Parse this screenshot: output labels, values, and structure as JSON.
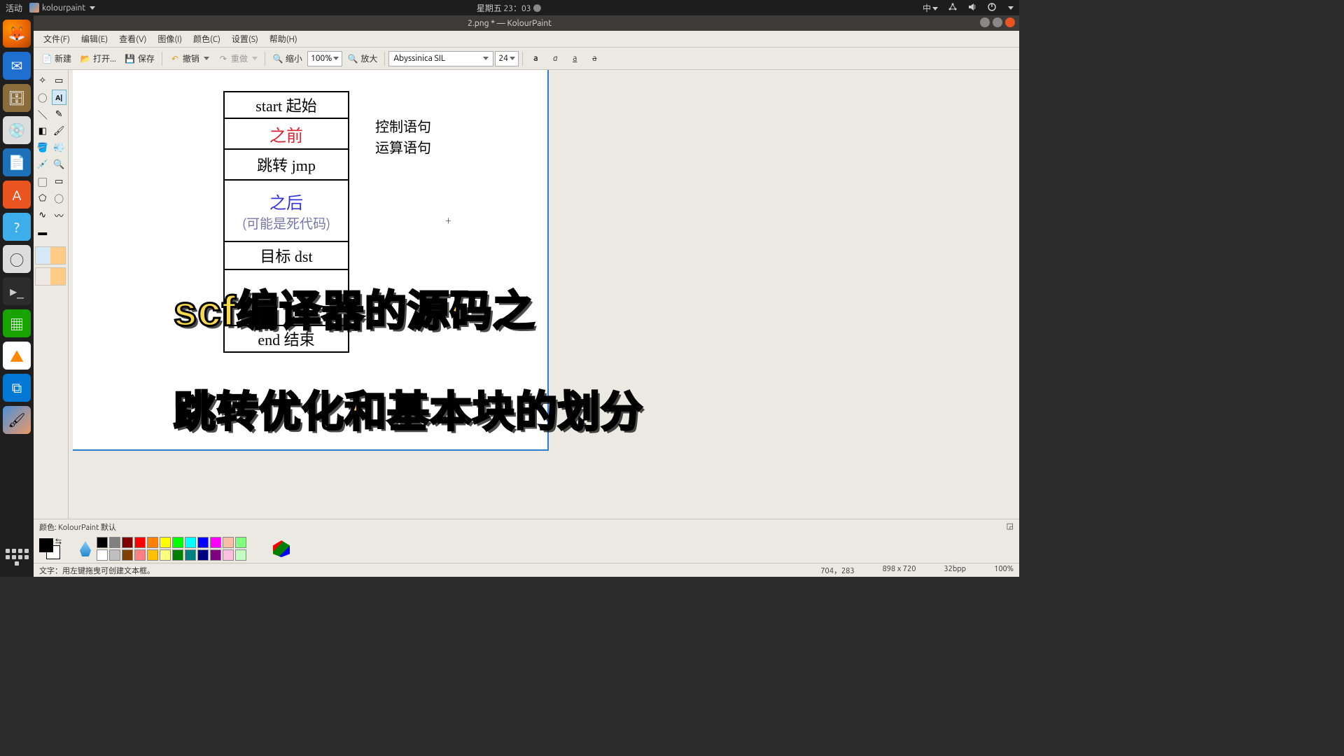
{
  "topbar": {
    "activities": "活动",
    "app_name": "kolourpaint",
    "clock": "星期五 23：03",
    "input": "中"
  },
  "titlebar": {
    "title": "2.png * — KolourPaint"
  },
  "menu": {
    "file": "文件(F)",
    "edit": "编辑(E)",
    "view": "查看(V)",
    "image": "图像(I)",
    "color": "颜色(C)",
    "settings": "设置(S)",
    "help": "帮助(H)"
  },
  "toolbar": {
    "new": "新建",
    "open": "打开...",
    "save": "保存",
    "undo": "撤销",
    "redo": "重做",
    "zoom_out": "缩小",
    "zoom_pct": "100%",
    "zoom_in": "放大",
    "font": "Abyssinica SIL",
    "font_size": "24"
  },
  "canvas": {
    "diagram": {
      "r1": "start  起始",
      "r2": "之前",
      "r3": "跳转  jmp",
      "r4a": "之后",
      "r4b": "(可能是死代码)",
      "r5": "目标  dst",
      "r6": "end  结束"
    },
    "side1": "控制语句",
    "side2": "运算语句",
    "overlay1": "scf编译器的源码之",
    "overlay2": "跳转优化和基本块的划分"
  },
  "colorbar": {
    "label": "颜色:  KolourPaint 默认"
  },
  "palette": {
    "row1": [
      "#000000",
      "#808080",
      "#800000",
      "#ff0000",
      "#ff8000",
      "#ffff00",
      "#00ff00",
      "#00ffff",
      "#0000ff",
      "#ff00ff",
      "#fabea7",
      "#80ff80"
    ],
    "row2": [
      "#ffffff",
      "#c0c0c0",
      "#804000",
      "#ff8080",
      "#ffc000",
      "#ffff80",
      "#008000",
      "#008080",
      "#000080",
      "#800080",
      "#ffc0e0",
      "#c0ffc0"
    ]
  },
  "status": {
    "hint": "文字：用左键拖曳可创建文本框。",
    "coords": "704，283",
    "dims": "898 x 720",
    "depth": "32bpp",
    "zoom": "100%"
  }
}
